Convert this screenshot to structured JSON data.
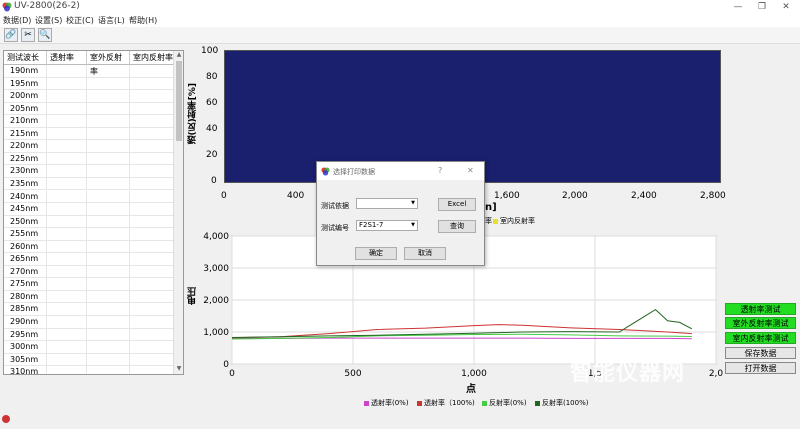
{
  "window": {
    "title": "UV-2800(26-2)",
    "min": "—",
    "restore": "❐",
    "close": "✕"
  },
  "menu": [
    "数据(D)",
    "设置(S)",
    "校正(C)",
    "语言(L)",
    "帮助(H)"
  ],
  "toolbar": [
    {
      "icon": "link-icon",
      "glyph": "🔗"
    },
    {
      "icon": "tools-icon",
      "glyph": "✂"
    },
    {
      "icon": "search-icon",
      "glyph": "🔍"
    }
  ],
  "table": {
    "headers": [
      "测试波长",
      "透射率",
      "室外反射率",
      "室内反射率"
    ],
    "rows": [
      "190nm",
      "195nm",
      "200nm",
      "205nm",
      "210nm",
      "215nm",
      "220nm",
      "225nm",
      "230nm",
      "235nm",
      "240nm",
      "245nm",
      "250nm",
      "255nm",
      "260nm",
      "265nm",
      "270nm",
      "275nm",
      "280nm",
      "285nm",
      "290nm",
      "295nm",
      "300nm",
      "305nm",
      "310nm"
    ]
  },
  "top_chart": {
    "ylabel": "透(反)射率[%]",
    "yticks": [
      "100",
      "80",
      "60",
      "40",
      "20",
      "0"
    ],
    "xticks": [
      "0",
      "400",
      "1,600",
      "2,000",
      "2,400",
      "2,800"
    ],
    "xlabel_fragment": "n]",
    "legend_fragment": "率",
    "legend_item": "室内反射率",
    "bg_color": "#1a1f6e"
  },
  "chart_data": {
    "type": "line",
    "ylabel": "电压",
    "xlabel": "点",
    "ylim": [
      0,
      4000
    ],
    "xlim": [
      0,
      2000
    ],
    "yticks": [
      "4,000",
      "3,000",
      "2,000",
      "1,000",
      "0"
    ],
    "xticks": [
      "0",
      "500",
      "1,000",
      "1,5",
      "2,0"
    ],
    "series": [
      {
        "name": "透射率(0%)",
        "color": "#cc44cc",
        "x": [
          0,
          200,
          400,
          600,
          800,
          1000,
          1200,
          1400,
          1600,
          1800,
          1900
        ],
        "values": [
          800,
          800,
          810,
          810,
          810,
          810,
          810,
          800,
          800,
          800,
          790
        ]
      },
      {
        "name": "透射率（100%)",
        "color": "#cc3333",
        "x": [
          0,
          200,
          400,
          600,
          800,
          1000,
          1100,
          1200,
          1400,
          1600,
          1800,
          1900
        ],
        "values": [
          820,
          850,
          950,
          1080,
          1120,
          1200,
          1230,
          1210,
          1130,
          1080,
          1000,
          950
        ]
      },
      {
        "name": "反射率(0%)",
        "color": "#44cc44",
        "x": [
          0,
          200,
          400,
          600,
          800,
          1000,
          1200,
          1400,
          1600,
          1800,
          1900
        ],
        "values": [
          780,
          800,
          830,
          880,
          900,
          920,
          930,
          910,
          880,
          870,
          860
        ]
      },
      {
        "name": "反射率(100%)",
        "color": "#226622",
        "x": [
          0,
          200,
          400,
          600,
          800,
          1000,
          1200,
          1400,
          1600,
          1750,
          1800,
          1850,
          1900
        ],
        "values": [
          830,
          850,
          880,
          900,
          930,
          960,
          1000,
          1010,
          1000,
          1700,
          1350,
          1300,
          1100
        ]
      }
    ]
  },
  "dialog": {
    "title": "选择打印数据",
    "help": "?",
    "close": "✕",
    "basis_label": "测试依据",
    "basis_value": "",
    "excel": "Excel",
    "number_label": "测试编号",
    "number_value": "F2S1-7",
    "query": "查询",
    "ok": "确定",
    "cancel": "取消"
  },
  "side_buttons": [
    "透射率测试",
    "室外反射率测试",
    "室内反射率测试",
    "保存数据",
    "打开数据"
  ],
  "watermark": "智能仪器网"
}
